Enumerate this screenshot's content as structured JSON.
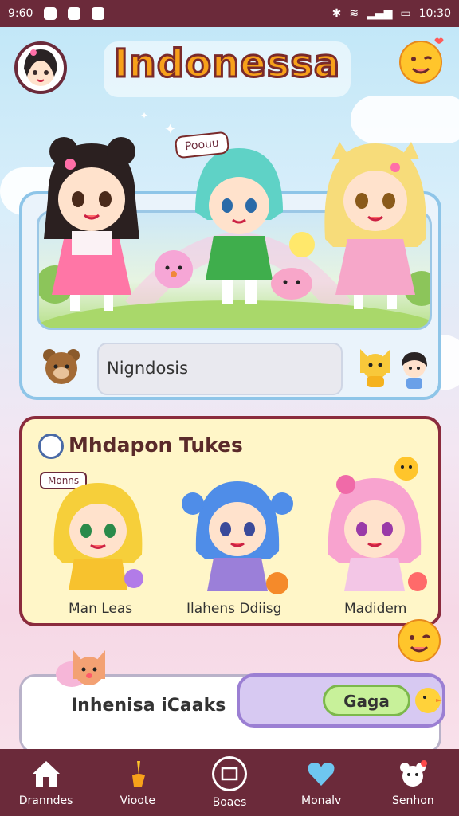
{
  "status": {
    "time": "9:60",
    "clock": "10:30"
  },
  "header": {
    "title": "Indonessa"
  },
  "hero": {
    "tag": "Poouu",
    "search_placeholder": "Nigndosis"
  },
  "section": {
    "title": "Mhdapon Tukes",
    "tag": "Monns",
    "characters": [
      {
        "name": "Man Leas"
      },
      {
        "name": "Ilahens Ddiisg"
      },
      {
        "name": "Madidem"
      }
    ]
  },
  "bottom_card": {
    "label": "Inhenisa iCaaks",
    "button": "Gaga"
  },
  "nav": [
    {
      "label": "Dranndes",
      "icon": "home-icon"
    },
    {
      "label": "Vioote",
      "icon": "brush-icon"
    },
    {
      "label": "Boaes",
      "icon": "camera-icon"
    },
    {
      "label": "Monalv",
      "icon": "heart-icon"
    },
    {
      "label": "Senhon",
      "icon": "bear-icon"
    }
  ],
  "colors": {
    "accent": "#f7a11a",
    "nav": "#6b2a3a",
    "section_border": "#8b2b3d"
  }
}
